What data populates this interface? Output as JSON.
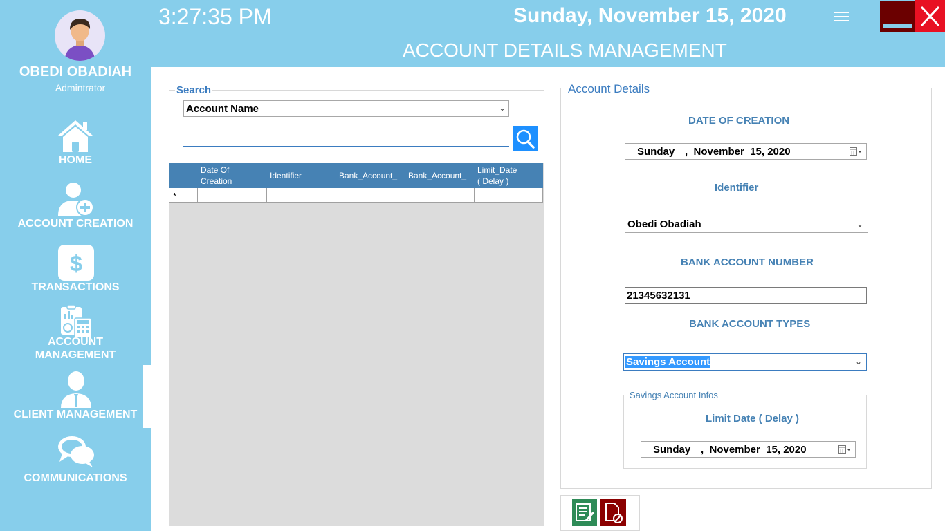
{
  "user": {
    "name": "OBEDI OBADIAH",
    "role": "Admintrator"
  },
  "nav": {
    "home": "HOME",
    "account_creation": "ACCOUNT CREATION",
    "transactions": "TRANSACTIONS",
    "account_management_line1": "ACCOUNT",
    "account_management_line2": "MANAGEMENT",
    "client_management": "CLIENT MANAGEMENT",
    "communications": "COMMUNICATIONS"
  },
  "header": {
    "time": "3:27:35 PM",
    "date": "Sunday, November 15, 2020",
    "title": "ACCOUNT DETAILS MANAGEMENT"
  },
  "search": {
    "legend": "Search",
    "field_select": "Account Name",
    "query": ""
  },
  "grid": {
    "columns": [
      {
        "label": "Date Of\nCreation"
      },
      {
        "label": "Identifier"
      },
      {
        "label": "Bank_Account_"
      },
      {
        "label": "Bank_Account_"
      },
      {
        "label": "Limit_Date\n( Delay )"
      }
    ],
    "new_row_marker": "*"
  },
  "details": {
    "legend": "Account Details",
    "date_of_creation_label": "DATE OF CREATION",
    "date_of_creation_day": "Sunday",
    "date_of_creation_rest": ",  November  15, 2020",
    "identifier_label": "Identifier",
    "identifier_value": "Obedi Obadiah",
    "account_number_label": "BANK ACCOUNT NUMBER",
    "account_number_value": "21345632131",
    "account_types_label": "BANK ACCOUNT TYPES",
    "account_type_value": "Savings Account",
    "savings": {
      "legend": "Savings Account Infos",
      "limit_label": "Limit Date ( Delay )",
      "limit_day": "Sunday",
      "limit_rest": ",  November  15, 2020"
    }
  },
  "icons": {
    "menu": "hamburger-icon",
    "minimize": "minimize-icon",
    "close": "close-icon",
    "search": "magnifier-icon",
    "save": "edit-document-icon",
    "cancel": "cancel-document-icon"
  },
  "colors": {
    "sky": "#87ceeb",
    "accent_blue": "#4682b4",
    "save_green": "#2e8b57",
    "cancel_red": "#8b0000",
    "close_red": "#e81123"
  }
}
